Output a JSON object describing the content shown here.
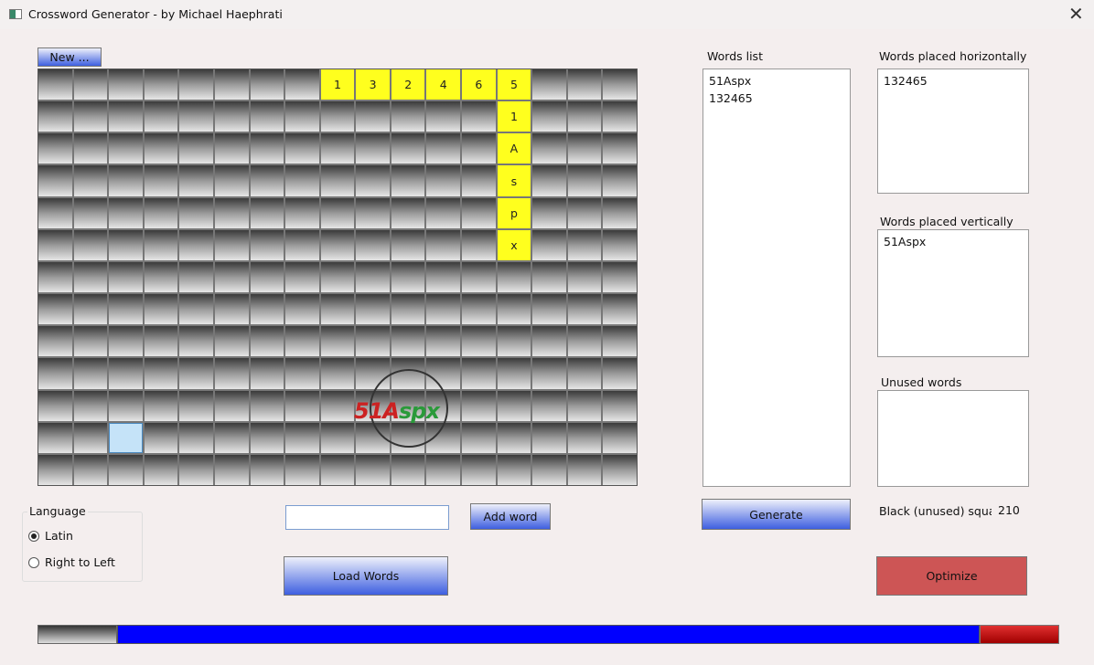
{
  "window": {
    "title": "Crossword Generator - by Michael Haephrati",
    "close_icon": "close-icon"
  },
  "toolbar": {
    "new_label": "New ..."
  },
  "grid": {
    "rows": 13,
    "cols": 17,
    "letters": [
      {
        "row": 0,
        "col": 8,
        "letter": "1"
      },
      {
        "row": 0,
        "col": 9,
        "letter": "3"
      },
      {
        "row": 0,
        "col": 10,
        "letter": "2"
      },
      {
        "row": 0,
        "col": 11,
        "letter": "4"
      },
      {
        "row": 0,
        "col": 12,
        "letter": "6"
      },
      {
        "row": 0,
        "col": 13,
        "letter": "5"
      },
      {
        "row": 1,
        "col": 13,
        "letter": "1"
      },
      {
        "row": 2,
        "col": 13,
        "letter": "A"
      },
      {
        "row": 3,
        "col": 13,
        "letter": "s"
      },
      {
        "row": 4,
        "col": 13,
        "letter": "p"
      },
      {
        "row": 5,
        "col": 13,
        "letter": "x"
      }
    ],
    "selected": {
      "row": 11,
      "col": 2
    }
  },
  "watermark": {
    "text_red": "51A",
    "text_green": "spx"
  },
  "words_list": {
    "label": "Words list",
    "items": [
      "51Aspx",
      "132465"
    ]
  },
  "horizontal": {
    "label": "Words placed horizontally",
    "items": [
      "132465"
    ]
  },
  "vertical": {
    "label": "Words placed vertically",
    "items": [
      "51Aspx"
    ]
  },
  "unused": {
    "label": "Unused words",
    "items": []
  },
  "language": {
    "label": "Language",
    "options": [
      {
        "label": "Latin",
        "checked": true
      },
      {
        "label": "Right to Left",
        "checked": false
      }
    ]
  },
  "word_input": {
    "value": "",
    "placeholder": ""
  },
  "buttons": {
    "add_word": "Add word",
    "load_words": "Load Words",
    "generate": "Generate",
    "optimize": "Optimize"
  },
  "stats": {
    "black_label": "Black (unused) square",
    "black_value": "210"
  },
  "colors": {
    "letter": "#ffff1e",
    "bar_blue": "#0000ff",
    "bar_red": "#c01010",
    "optimize": "#cd5555"
  }
}
